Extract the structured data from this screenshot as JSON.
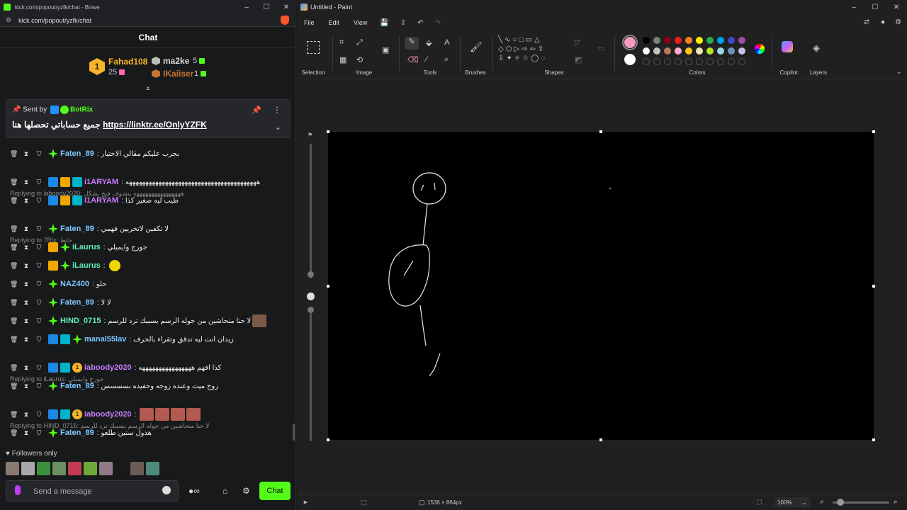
{
  "browser": {
    "window_title": "kick.com/popout/yzfk/chat - Brave",
    "url": "kick.com/popout/yzfk/chat"
  },
  "chat": {
    "header_title": "Chat",
    "leaderboard": {
      "first": {
        "rank": "1",
        "name": "Fahad108",
        "count": "25"
      },
      "second": {
        "name": "ma2ke",
        "count": "5"
      },
      "third": {
        "name": "IKaiiser",
        "count": "1"
      }
    },
    "pinned": {
      "sent_by_label": "Sent by",
      "bot_name": "BotRix",
      "message_text": "جميع حساباتي تحصلها هنا",
      "link": "https://linktr.ee/OnlyYZFK"
    },
    "messages": [
      {
        "name": "Faten_89",
        "color": "#7ec8ff",
        "text": "بجرب عليكم مقالي الاختبار",
        "badges": [
          "green"
        ]
      },
      {
        "reply": "Replying to laboody2020: ههههههههههههههههه بنشوف فيح بشكل"
      },
      {
        "name": "i1ARYAM",
        "color": "#c77dff",
        "text": "ههههههههههههههههههههههههههههههههههههههههه",
        "badges": [
          "blue",
          "gold",
          "cyan"
        ]
      },
      {
        "name": "i1ARYAM",
        "color": "#c77dff",
        "text": "طيب ليه صغير كذا",
        "badges": [
          "blue",
          "gold",
          "cyan"
        ]
      },
      {
        "reply": "Replying to 7Rix: خلط"
      },
      {
        "name": "Faten_89",
        "color": "#7ec8ff",
        "text": "لا تكفين لاتخربين فهمي",
        "badges": [
          "green"
        ]
      },
      {
        "name": "iLaurus",
        "color": "#5ef0c0",
        "text": "جورج وايميلي",
        "badges": [
          "gold",
          "green"
        ]
      },
      {
        "name": "iLaurus",
        "color": "#5ef0c0",
        "text": "",
        "badges": [
          "gold",
          "green"
        ],
        "emote": "yellow"
      },
      {
        "name": "NAZ400",
        "color": "#7ec8ff",
        "text": "حلو",
        "badges": [
          "green"
        ]
      },
      {
        "name": "Faten_89",
        "color": "#7ec8ff",
        "text": "لا لا",
        "badges": [
          "green"
        ]
      },
      {
        "name": "HIND_0715",
        "color": "#5ef0c0",
        "text": "لا حنا منحاشين من جوله الرسم بسببك ترد للرسم",
        "badges": [
          "green"
        ],
        "emote": "face"
      },
      {
        "name": "manal55lav",
        "color": "#7ec8ff",
        "text": "زيدان انت ليه تدقق وتقراء بالحرف",
        "badges": [
          "blue",
          "cyan",
          "green"
        ]
      },
      {
        "reply": "Replying to iLaurus: جورج وايميلي"
      },
      {
        "name": "iaboody2020",
        "color": "#c77dff",
        "text": "كذا افهم ههههههههههههههههه",
        "badges": [
          "blue",
          "cyan",
          "sub1"
        ]
      },
      {
        "name": "Faten_89",
        "color": "#7ec8ff",
        "text": "زوج ميت وعنده زوجه وحفيده بسسسس",
        "badges": [
          "green"
        ]
      },
      {
        "reply": "Replying to HIND_0715: لا حنا منحاشين من جوله الرسم بسببك ترد للرسم"
      },
      {
        "name": "iaboody2020",
        "color": "#c77dff",
        "text": "",
        "badges": [
          "blue",
          "cyan",
          "sub1"
        ],
        "emote": "faces"
      },
      {
        "name": "Faten_89",
        "color": "#7ec8ff",
        "text": "هذول سنين طلعو",
        "badges": [
          "green"
        ]
      }
    ],
    "followers_only": "Followers only",
    "input_placeholder": "Send a message",
    "chat_button": "Chat"
  },
  "paint": {
    "window_title": "Untitled - Paint",
    "menu": {
      "file": "File",
      "edit": "Edit",
      "view": "View"
    },
    "groups": {
      "selection": "Selection",
      "image": "Image",
      "tools": "Tools",
      "brushes": "Brushes",
      "shapes": "Shapes",
      "colors": "Colors",
      "copilot": "Copilot",
      "layers": "Layers"
    },
    "status": {
      "canvas_size": "1536 × 864px",
      "zoom": "100%"
    },
    "colors": {
      "primary": "#f49ac1",
      "secondary": "#ffffff",
      "row1": [
        "#000000",
        "#7f7f7f",
        "#880015",
        "#ed1c24",
        "#ff7f27",
        "#fff200",
        "#22b14c",
        "#00a2e8",
        "#3f48cc",
        "#a349a4"
      ],
      "row2": [
        "#ffffff",
        "#c3c3c3",
        "#b97a57",
        "#ffaec9",
        "#ffc90e",
        "#efe4b0",
        "#b5e61d",
        "#99d9ea",
        "#7092be",
        "#c8bfe7"
      ]
    }
  }
}
